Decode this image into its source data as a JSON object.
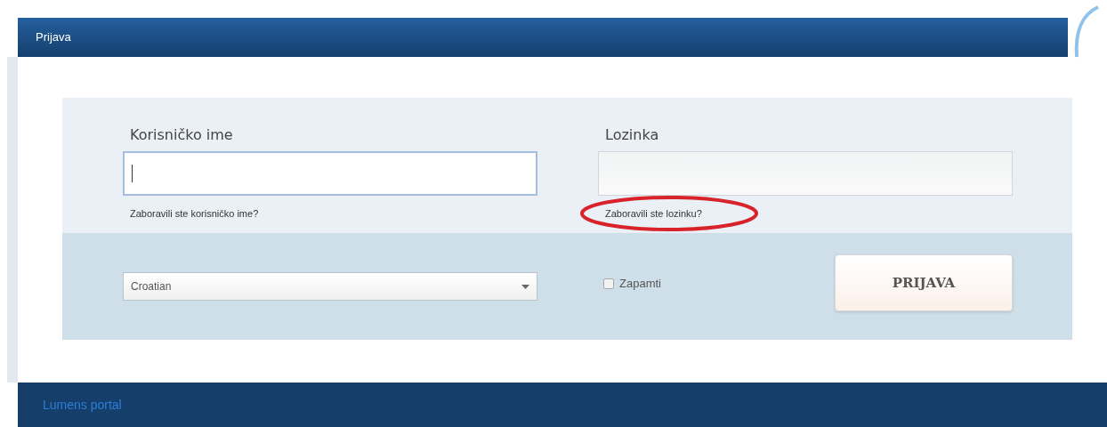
{
  "header": {
    "title": "Prijava"
  },
  "fields": [
    {
      "label": "Korisničko ime",
      "focused": true,
      "link": "Zaboravili ste korisničko ime?",
      "highlighted": false
    },
    {
      "label": "Lozinka",
      "focused": false,
      "link": "Zaboravili ste lozinku?",
      "highlighted": true
    }
  ],
  "language": {
    "value": "Croatian"
  },
  "remember": {
    "label": "Zapamti",
    "checked": false
  },
  "submit": {
    "label": "PRIJAVA"
  },
  "footer": {
    "text": "Lumens portal"
  }
}
